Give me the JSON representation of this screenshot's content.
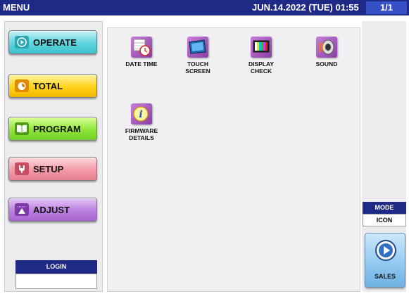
{
  "titlebar": {
    "title": "MENU",
    "datetime": "JUN.14.2022 (TUE) 01:55",
    "page": "1/1"
  },
  "left_menu": {
    "operate": "OPERATE",
    "total": "TOTAL",
    "program": "PROGRAM",
    "setup": "SETUP",
    "adjust": "ADJUST"
  },
  "login": {
    "label": "LOGIN",
    "value": ""
  },
  "icons": {
    "date_time": {
      "line1": "DATE TIME",
      "line2": ""
    },
    "touch_screen": {
      "line1": "TOUCH",
      "line2": "SCREEN"
    },
    "display_check": {
      "line1": "DISPLAY",
      "line2": "CHECK"
    },
    "sound": {
      "line1": "SOUND",
      "line2": ""
    },
    "firmware_details": {
      "line1": "FIRMWARE",
      "line2": "DETAILS"
    }
  },
  "mode": {
    "label": "MODE",
    "value": "ICON"
  },
  "sales": {
    "label": "SALES"
  },
  "colors": {
    "titlebar": "#1e2a86",
    "accent": "#3651c8"
  }
}
